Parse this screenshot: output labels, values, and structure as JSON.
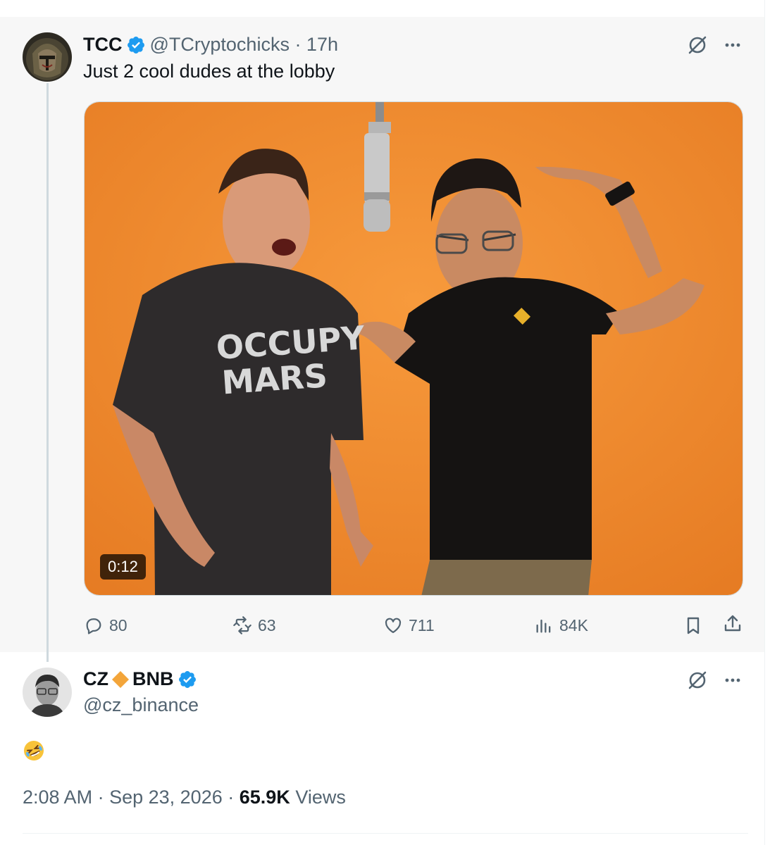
{
  "colors": {
    "verified": "#1d9bf0",
    "secondary_text": "#536471",
    "primary_text": "#0f1419",
    "media_background": "#f0862a",
    "bnb_diamond": "#f0b90b"
  },
  "tweet": {
    "author_name": "TCC",
    "handle_time": "@TCryptochicks · 17h",
    "text": "Just 2 cool dudes at the lobby",
    "video": {
      "duration": "0:12",
      "shirt_line1": "OCCUPY",
      "shirt_line2": "MARS"
    },
    "actions": {
      "replies": "80",
      "reposts": "63",
      "likes": "711",
      "views": "84K"
    },
    "icons": [
      "grok-icon",
      "more-icon",
      "reply-icon",
      "repost-icon",
      "like-icon",
      "views-icon",
      "bookmark-icon",
      "share-icon"
    ]
  },
  "reply": {
    "name_part1": "CZ",
    "name_part2": "BNB",
    "handle": "@cz_binance",
    "emoji": "🤣",
    "time": "2:08 AM",
    "date": "Sep 23, 2026",
    "views_count": "65.9K",
    "views_label": "Views"
  }
}
